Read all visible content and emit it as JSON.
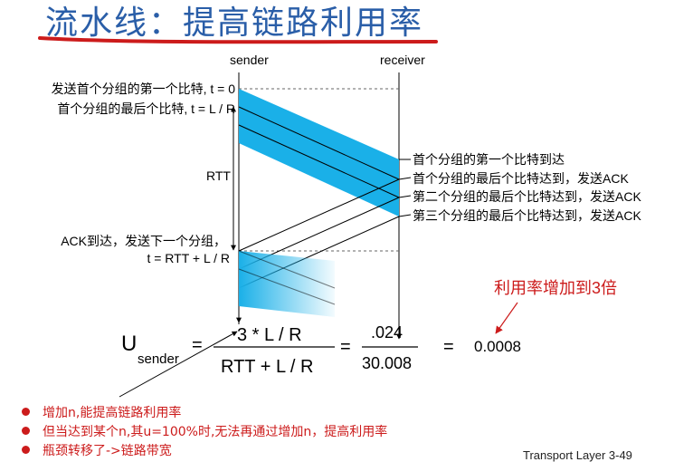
{
  "title": "流水线：提高链路利用率",
  "sender_label": "sender",
  "receiver_label": "receiver",
  "left_labels": {
    "first_bit": "发送首个分组的第一个比特, t = 0",
    "last_bit": "首个分组的最后个比特, t = L / R",
    "rtt": "RTT",
    "ack_arrive": "ACK到达，发送下一个分组，",
    "ack_time": "t = RTT + L / R"
  },
  "right_labels": {
    "r1": "首个分组的第一个比特到达",
    "r2": "首个分组的最后个比特达到，发送ACK",
    "r3": "第二个分组的最后个比特达到，发送ACK",
    "r4": "第三个分组的最后个比特达到，发送ACK"
  },
  "annotation": "利用率增加到3倍",
  "equation": {
    "u": "U",
    "sub": "sender",
    "num": "3 * L / R",
    "den": "RTT + L / R",
    "eq1": "=",
    "eq2": "=",
    "eq3": "=",
    "num2": ".024",
    "den2": "30.008",
    "result": "0.0008"
  },
  "bullets": [
    "增加n,能提高链路利用率",
    "但当达到某个n,其u=100%时,无法再通过增加n，提高利用率",
    "瓶颈转移了->链路带宽"
  ],
  "footer": "Transport Layer   3-49",
  "colors": {
    "title": "#2a5ea8",
    "accent_red": "#cc1b1b",
    "packet_cyan": "#1ab0e8"
  }
}
